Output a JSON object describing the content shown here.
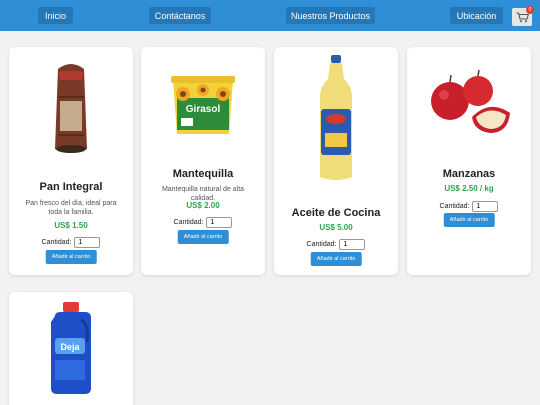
{
  "nav": {
    "inicio": "Inicio",
    "contacto": "Contáctanos",
    "productos": "Nuestros Productos",
    "ubicacion": "Ubicación",
    "cart_count": "0"
  },
  "labels": {
    "cantidad": "Cantidad:",
    "add_button": "Añadir al carrito"
  },
  "products": [
    {
      "name": "Pan Integral",
      "description": "Pan fresco del día, ideal para toda la familia.",
      "price": "US$ 1.50",
      "qty": "1",
      "image_icon": "bread-loaf-image"
    },
    {
      "name": "Mantequilla",
      "description": "Mantequilla natural de alta calidad.",
      "price": "US$ 2.00",
      "qty": "1",
      "image_icon": "margarine-tub-image"
    },
    {
      "name": "Aceite de Cocina",
      "price": "US$ 5.00",
      "qty": "1",
      "image_icon": "oil-bottle-image"
    },
    {
      "name": "Manzanas",
      "price": "US$ 2.50 / kg",
      "qty": "1",
      "image_icon": "apples-image"
    },
    {
      "image_icon": "detergent-bottle-image"
    }
  ],
  "colors": {
    "nav_bar": "#2f8fd6",
    "nav_button": "#2577b8",
    "price": "#2ea44f",
    "add_button": "#2f8fd6"
  }
}
